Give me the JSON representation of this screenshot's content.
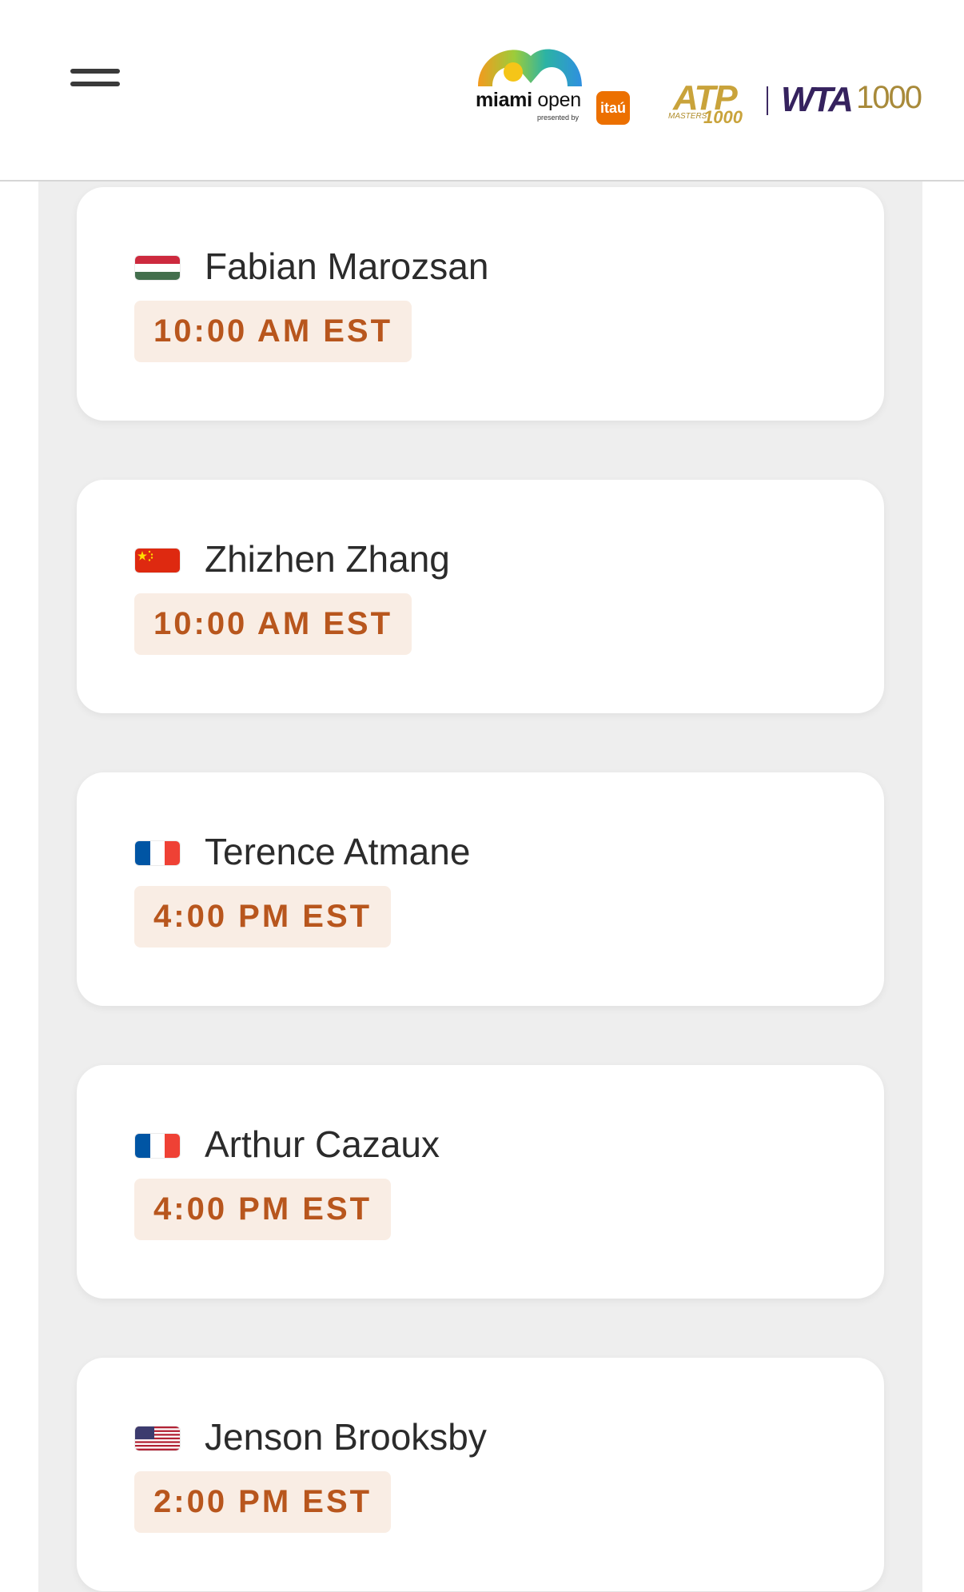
{
  "header": {
    "menu_icon": "hamburger-menu-icon",
    "miami_open": {
      "bold": "miami",
      "regular": " open",
      "presented_by": "presented by",
      "sponsor": "itaú"
    },
    "atp": {
      "text": "ATP",
      "masters": "MASTERS",
      "number": "1000"
    },
    "wta": {
      "text": "WTA",
      "number": "1000"
    }
  },
  "players": [
    {
      "name": "Fabian Marozsan",
      "country": "Hungary",
      "time": "10:00 AM EST"
    },
    {
      "name": "Zhizhen Zhang",
      "country": "China",
      "time": "10:00 AM EST"
    },
    {
      "name": "Terence Atmane",
      "country": "France",
      "time": "4:00 PM EST"
    },
    {
      "name": "Arthur Cazaux",
      "country": "France",
      "time": "4:00 PM EST"
    },
    {
      "name": "Jenson Brooksby",
      "country": "United States",
      "time": "2:00 PM EST"
    }
  ],
  "colors": {
    "time_text": "#b8561d",
    "time_bg": "#f9ede4",
    "page_bg": "#eeeeee",
    "wta_purple": "#35225e",
    "atp_gold": "#c9a33b",
    "itau_orange": "#ec7000"
  }
}
